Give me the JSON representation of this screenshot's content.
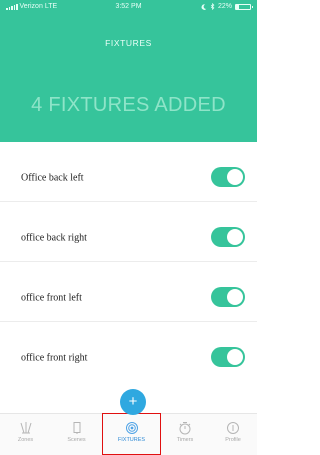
{
  "status_bar": {
    "carrier": "Verizon",
    "network": "LTE",
    "time": "3:52 PM",
    "battery_percent": "22%",
    "battery_level": 0.22
  },
  "header": {
    "nav_title": "FIXTURES",
    "headline": "4 FIXTURES ADDED"
  },
  "fixtures": [
    {
      "name": "Office back left",
      "enabled": true
    },
    {
      "name": "office back right",
      "enabled": true
    },
    {
      "name": "office front left",
      "enabled": true
    },
    {
      "name": "office front right",
      "enabled": true
    }
  ],
  "add_button": {
    "symbol": "+"
  },
  "tabs": [
    {
      "label": "Zones",
      "icon": "zones-icon",
      "active": false
    },
    {
      "label": "Scenes",
      "icon": "scenes-icon",
      "active": false
    },
    {
      "label": "FIXTURES",
      "icon": "fixtures-icon",
      "active": true
    },
    {
      "label": "Timers",
      "icon": "timer-icon",
      "active": false
    },
    {
      "label": "Profile",
      "icon": "profile-icon",
      "active": false
    }
  ],
  "colors": {
    "accent_green": "#36c49b",
    "headline_green": "#8ee4c8",
    "add_button_blue": "#2fa8e0",
    "active_tab_blue": "#2f8bd6",
    "highlight_red": "#e01010"
  }
}
